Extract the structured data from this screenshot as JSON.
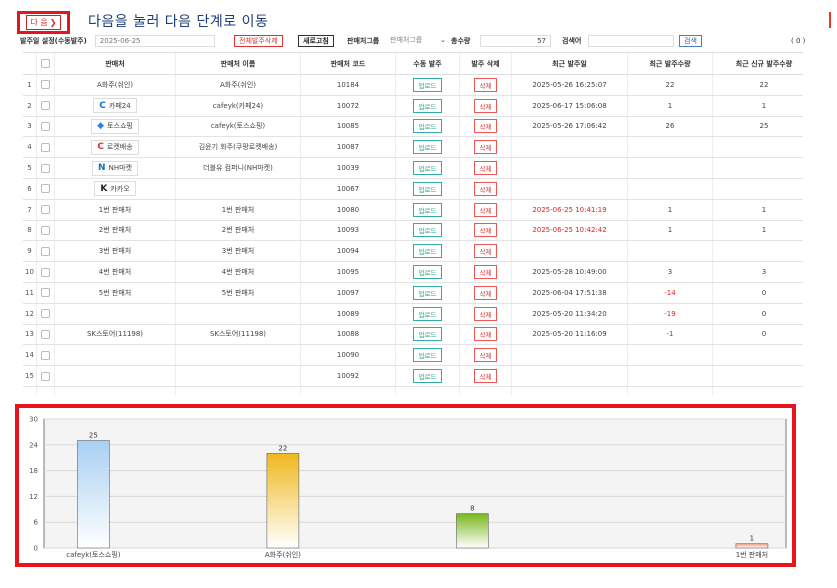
{
  "annotation": {
    "next_label": "다 음",
    "next_arrow": "❯",
    "headline": "다음을 눌러 다음 단계로 이동"
  },
  "toolbar": {
    "date_label": "발주일 설정(수동발주)",
    "date_value": "2025-06-25",
    "delete_all_label": "전체발주삭제",
    "refresh_label": "새로고침",
    "group_label": "판매처그룹",
    "group_placeholder": "판매처그룹",
    "total_label": "총수량",
    "total_value": "57",
    "search_label": "검색어",
    "search_button": "검색",
    "count_text": "( 0 )"
  },
  "table": {
    "headers": {
      "store": "판매처",
      "name": "판매처 이름",
      "code": "판매처 코드",
      "upload": "수동 발주",
      "delete": "발주 삭제",
      "date": "최근 발주일",
      "qty": "최근 발주수량",
      "new_qty": "최근 신규 발주수량"
    },
    "upload_label": "업로드",
    "delete_label": "삭제",
    "rows": [
      {
        "num": "1",
        "store": "A화주(쉬인)",
        "logo": "",
        "logo_color": "",
        "name": "A화주(쉬인)",
        "code": "10184",
        "date": "2025-05-26 16:25:07",
        "date_red": false,
        "qty": "22",
        "qty_red": false,
        "new_qty": "22"
      },
      {
        "num": "2",
        "store": "카페24",
        "logo": "C",
        "logo_color": "#1e6bd6",
        "name": "cafeyk(카페24)",
        "code": "10072",
        "date": "2025-06-17 15:06:08",
        "date_red": false,
        "qty": "1",
        "qty_red": false,
        "new_qty": "1"
      },
      {
        "num": "3",
        "store": "토스쇼핑",
        "logo": "◆",
        "logo_color": "#2f7cf6",
        "name": "cafeyk(토스쇼핑)",
        "code": "10085",
        "date": "2025-05-26 17:06:42",
        "date_red": false,
        "qty": "26",
        "qty_red": false,
        "new_qty": "25"
      },
      {
        "num": "4",
        "store": "로켓배송",
        "logo": "C",
        "logo_color": "#e4322b",
        "name": "김윤기 화주(쿠팡로켓배송)",
        "code": "10087",
        "date": "",
        "date_red": false,
        "qty": "",
        "qty_red": false,
        "new_qty": ""
      },
      {
        "num": "5",
        "store": "NH마켓",
        "logo": "N",
        "logo_color": "#1b6bb5",
        "name": "더블유 컴퍼니(NH마켓)",
        "code": "10039",
        "date": "",
        "date_red": false,
        "qty": "",
        "qty_red": false,
        "new_qty": ""
      },
      {
        "num": "6",
        "store": "카카오",
        "logo": "K",
        "logo_color": "#222222",
        "name": "",
        "code": "10067",
        "date": "",
        "date_red": false,
        "qty": "",
        "qty_red": false,
        "new_qty": ""
      },
      {
        "num": "7",
        "store": "1번 판매처",
        "logo": "",
        "logo_color": "",
        "name": "1번 판매처",
        "code": "10080",
        "date": "2025-06-25 10:41:19",
        "date_red": true,
        "qty": "1",
        "qty_red": false,
        "new_qty": "1"
      },
      {
        "num": "8",
        "store": "2번 판매처",
        "logo": "",
        "logo_color": "",
        "name": "2번 판매처",
        "code": "10093",
        "date": "2025-06-25 10:42:42",
        "date_red": true,
        "qty": "1",
        "qty_red": false,
        "new_qty": "1"
      },
      {
        "num": "9",
        "store": "3번 판매처",
        "logo": "",
        "logo_color": "",
        "name": "3번 판매처",
        "code": "10094",
        "date": "",
        "date_red": false,
        "qty": "",
        "qty_red": false,
        "new_qty": ""
      },
      {
        "num": "10",
        "store": "4번 판매처",
        "logo": "",
        "logo_color": "",
        "name": "4번 판매처",
        "code": "10095",
        "date": "2025-05-28 10:49:00",
        "date_red": false,
        "qty": "3",
        "qty_red": false,
        "new_qty": "3"
      },
      {
        "num": "11",
        "store": "5번 판매처",
        "logo": "",
        "logo_color": "",
        "name": "5번 판매처",
        "code": "10097",
        "date": "2025-06-04 17:51:38",
        "date_red": false,
        "qty": "-14",
        "qty_red": true,
        "new_qty": "0"
      },
      {
        "num": "12",
        "store": "",
        "logo": "",
        "logo_color": "",
        "name": "",
        "code": "10089",
        "date": "2025-05-20 11:34:20",
        "date_red": false,
        "qty": "-19",
        "qty_red": true,
        "new_qty": "0"
      },
      {
        "num": "13",
        "store": "SK스토어(11198)",
        "logo": "",
        "logo_color": "",
        "name": "SK스토어(11198)",
        "code": "10088",
        "date": "2025-05-20 11:16:09",
        "date_red": false,
        "qty": "-1",
        "qty_red": true,
        "new_qty": "0"
      },
      {
        "num": "14",
        "store": "",
        "logo": "",
        "logo_color": "",
        "name": "",
        "code": "10090",
        "date": "",
        "date_red": false,
        "qty": "",
        "qty_red": false,
        "new_qty": ""
      },
      {
        "num": "15",
        "store": "",
        "logo": "",
        "logo_color": "",
        "name": "",
        "code": "10092",
        "date": "",
        "date_red": false,
        "qty": "",
        "qty_red": false,
        "new_qty": ""
      },
      {
        "num": "",
        "store": "",
        "logo": "",
        "logo_color": "",
        "name": "",
        "code": "",
        "date": "",
        "date_red": false,
        "qty": "",
        "qty_red": false,
        "new_qty": ""
      }
    ]
  },
  "chart_data": {
    "type": "bar",
    "categories": [
      "cafeyk(토스쇼핑)",
      "A화주(쉬인)",
      "",
      "1번 판매처"
    ],
    "values": [
      25,
      22,
      8,
      1
    ],
    "bar_colors": [
      "#a9cff3",
      "#f0b820",
      "#78b81e",
      "#ee9a80"
    ],
    "ylim": [
      0,
      30
    ],
    "yticks": [
      0,
      6,
      12,
      18,
      24,
      30
    ],
    "grid": true,
    "title": "",
    "xlabel": "",
    "ylabel": ""
  }
}
